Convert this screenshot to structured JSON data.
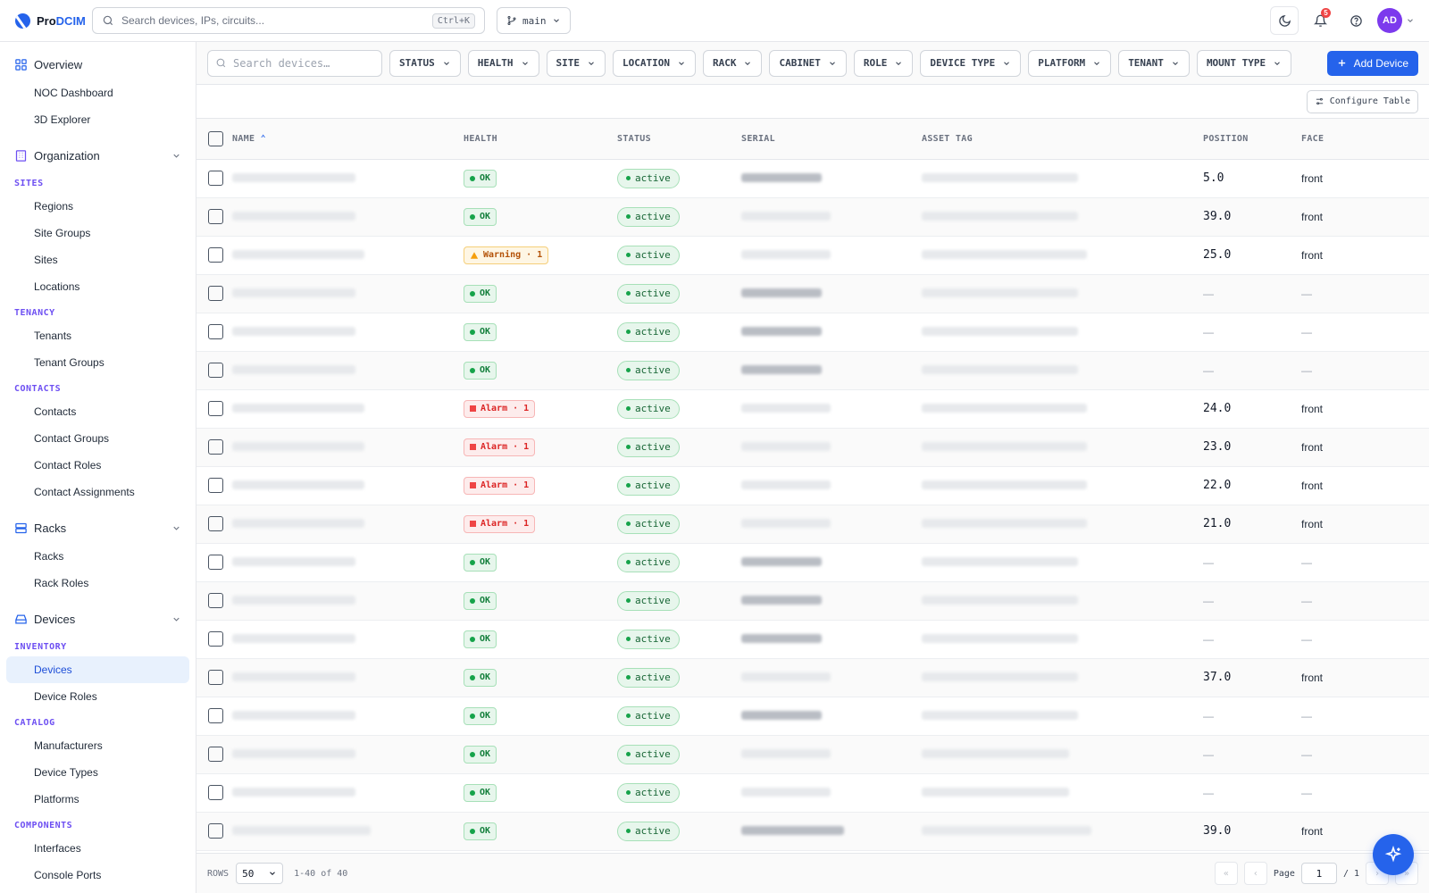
{
  "app": {
    "brand_a": "Pro",
    "brand_b": "DCIM"
  },
  "topbar": {
    "search_placeholder": "Search devices, IPs, circuits...",
    "search_shortcut": "Ctrl+K",
    "branch": "main",
    "notification_count": "5",
    "avatar_initials": "AD"
  },
  "sidebar": {
    "overview": "Overview",
    "noc_dashboard": "NOC Dashboard",
    "explorer_3d": "3D Explorer",
    "organization": "Organization",
    "sites_section": "SITES",
    "regions": "Regions",
    "site_groups": "Site Groups",
    "sites": "Sites",
    "locations": "Locations",
    "tenancy_section": "TENANCY",
    "tenants": "Tenants",
    "tenant_groups": "Tenant Groups",
    "contacts_section": "CONTACTS",
    "contacts": "Contacts",
    "contact_groups": "Contact Groups",
    "contact_roles": "Contact Roles",
    "contact_assignments": "Contact Assignments",
    "racks_group": "Racks",
    "racks": "Racks",
    "rack_roles": "Rack Roles",
    "devices_group": "Devices",
    "inventory_section": "INVENTORY",
    "devices": "Devices",
    "device_roles": "Device Roles",
    "catalog_section": "CATALOG",
    "manufacturers": "Manufacturers",
    "device_types": "Device Types",
    "platforms": "Platforms",
    "components_section": "COMPONENTS",
    "interfaces": "Interfaces",
    "console_ports": "Console Ports"
  },
  "filters": {
    "search_placeholder": "Search devices…",
    "status": "STATUS",
    "health": "HEALTH",
    "site": "SITE",
    "location": "LOCATION",
    "rack": "RACK",
    "cabinet": "CABINET",
    "role": "ROLE",
    "device_type": "DEVICE TYPE",
    "platform": "PLATFORM",
    "tenant": "TENANT",
    "mount_type": "MOUNT TYPE",
    "add_device": "Add Device"
  },
  "configure_table": "Configure Table",
  "table": {
    "headers": {
      "name": "NAME",
      "health": "HEALTH",
      "status": "STATUS",
      "serial": "SERIAL",
      "asset_tag": "ASSET TAG",
      "position": "POSITION",
      "face": "FACE"
    },
    "rows": [
      {
        "health": "OK",
        "health_kind": "ok",
        "status": "active",
        "position": "5.0",
        "face": "front"
      },
      {
        "health": "OK",
        "health_kind": "ok",
        "status": "active",
        "position": "39.0",
        "face": "front"
      },
      {
        "health": "Warning · 1",
        "health_kind": "warn",
        "status": "active",
        "position": "25.0",
        "face": "front"
      },
      {
        "health": "OK",
        "health_kind": "ok",
        "status": "active",
        "position": "—",
        "face": "—"
      },
      {
        "health": "OK",
        "health_kind": "ok",
        "status": "active",
        "position": "—",
        "face": "—"
      },
      {
        "health": "OK",
        "health_kind": "ok",
        "status": "active",
        "position": "—",
        "face": "—"
      },
      {
        "health": "Alarm · 1",
        "health_kind": "alarm",
        "status": "active",
        "position": "24.0",
        "face": "front"
      },
      {
        "health": "Alarm · 1",
        "health_kind": "alarm",
        "status": "active",
        "position": "23.0",
        "face": "front"
      },
      {
        "health": "Alarm · 1",
        "health_kind": "alarm",
        "status": "active",
        "position": "22.0",
        "face": "front"
      },
      {
        "health": "Alarm · 1",
        "health_kind": "alarm",
        "status": "active",
        "position": "21.0",
        "face": "front"
      },
      {
        "health": "OK",
        "health_kind": "ok",
        "status": "active",
        "position": "—",
        "face": "—"
      },
      {
        "health": "OK",
        "health_kind": "ok",
        "status": "active",
        "position": "—",
        "face": "—"
      },
      {
        "health": "OK",
        "health_kind": "ok",
        "status": "active",
        "position": "—",
        "face": "—"
      },
      {
        "health": "OK",
        "health_kind": "ok",
        "status": "active",
        "position": "37.0",
        "face": "front"
      },
      {
        "health": "OK",
        "health_kind": "ok",
        "status": "active",
        "position": "—",
        "face": "—"
      },
      {
        "health": "OK",
        "health_kind": "ok",
        "status": "active",
        "position": "—",
        "face": "—"
      },
      {
        "health": "OK",
        "health_kind": "ok",
        "status": "active",
        "position": "—",
        "face": "—"
      },
      {
        "health": "OK",
        "health_kind": "ok",
        "status": "active",
        "position": "39.0",
        "face": "front"
      }
    ]
  },
  "footer": {
    "rows_label": "ROWS",
    "rows_value": "50",
    "range": "1-40 of 40",
    "page_label": "Page",
    "page_value": "1",
    "page_total": "/ 1"
  },
  "colors": {
    "accent": "#2563eb",
    "section": "#6d4ff2",
    "ok": "#16a34a",
    "warn": "#d97706",
    "alarm": "#ef4444"
  }
}
